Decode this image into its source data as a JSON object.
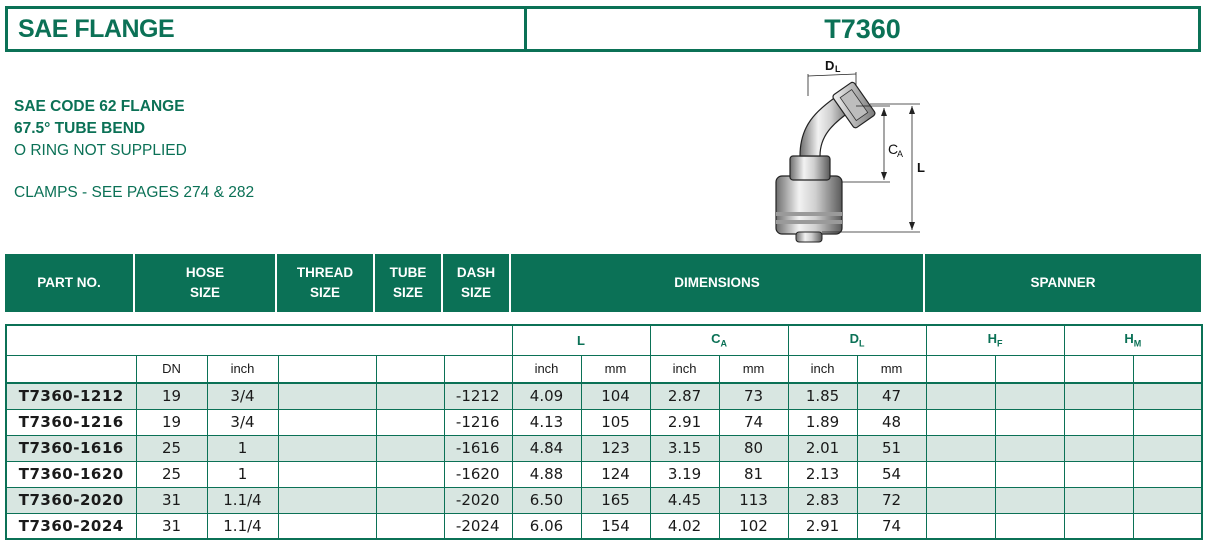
{
  "title": {
    "left": "SAE FLANGE",
    "right": "T7360"
  },
  "description": {
    "line1": "SAE CODE 62 FLANGE",
    "line2": "67.5° TUBE BEND",
    "line3": "O RING NOT SUPPLIED",
    "line4": "CLAMPS - SEE PAGES 274 & 282"
  },
  "drawing": {
    "dl_label": "D",
    "dl_sub": "L",
    "ca_label": "C",
    "ca_sub": "A",
    "l_label": "L"
  },
  "header": {
    "part_no": "PART NO.",
    "hose_size_1": "HOSE",
    "hose_size_2": "SIZE",
    "thread_1": "THREAD",
    "thread_2": "SIZE",
    "tube_1": "TUBE",
    "tube_2": "SIZE",
    "dash_1": "DASH",
    "dash_2": "SIZE",
    "dimensions": "DIMENSIONS",
    "spanner": "SPANNER"
  },
  "subheader": {
    "L": "L",
    "C": "C",
    "C_sub": "A",
    "D": "D",
    "D_sub": "L",
    "H1": "H",
    "H1_sub": "F",
    "H2": "H",
    "H2_sub": "M",
    "dn": "DN",
    "inch": "inch",
    "mm": "mm"
  },
  "rows": [
    {
      "part": "T7360-1212",
      "dn": "19",
      "inch": "3/4",
      "dash": "-1212",
      "l_in": "4.09",
      "l_mm": "104",
      "ca_in": "2.87",
      "ca_mm": "73",
      "dl_in": "1.85",
      "dl_mm": "47"
    },
    {
      "part": "T7360-1216",
      "dn": "19",
      "inch": "3/4",
      "dash": "-1216",
      "l_in": "4.13",
      "l_mm": "105",
      "ca_in": "2.91",
      "ca_mm": "74",
      "dl_in": "1.89",
      "dl_mm": "48"
    },
    {
      "part": "T7360-1616",
      "dn": "25",
      "inch": "1",
      "dash": "-1616",
      "l_in": "4.84",
      "l_mm": "123",
      "ca_in": "3.15",
      "ca_mm": "80",
      "dl_in": "2.01",
      "dl_mm": "51"
    },
    {
      "part": "T7360-1620",
      "dn": "25",
      "inch": "1",
      "dash": "-1620",
      "l_in": "4.88",
      "l_mm": "124",
      "ca_in": "3.19",
      "ca_mm": "81",
      "dl_in": "2.13",
      "dl_mm": "54"
    },
    {
      "part": "T7360-2020",
      "dn": "31",
      "inch": "1.1/4",
      "dash": "-2020",
      "l_in": "6.50",
      "l_mm": "165",
      "ca_in": "4.45",
      "ca_mm": "113",
      "dl_in": "2.83",
      "dl_mm": "72"
    },
    {
      "part": "T7360-2024",
      "dn": "31",
      "inch": "1.1/4",
      "dash": "-2024",
      "l_in": "6.06",
      "l_mm": "154",
      "ca_in": "4.02",
      "ca_mm": "102",
      "dl_in": "2.91",
      "dl_mm": "74"
    }
  ],
  "colors": {
    "brand_green": "#0b7156",
    "row_shade": "#d8e6e1"
  }
}
